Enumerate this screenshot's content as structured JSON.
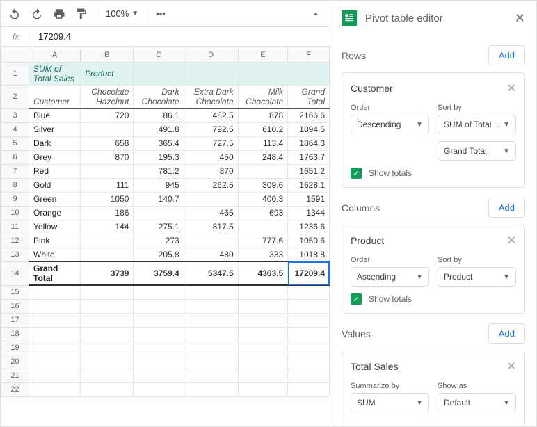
{
  "toolbar": {
    "zoom": "100%"
  },
  "fx": {
    "label": "fx",
    "value": "17209.4"
  },
  "grid": {
    "cols": [
      "A",
      "B",
      "C",
      "D",
      "E",
      "F"
    ],
    "hdr1": {
      "a": "SUM of Total Sales",
      "b": "Product"
    },
    "hdr2": [
      "Customer",
      "Chocolate Hazelnut",
      "Dark Chocolate",
      "Extra Dark Chocolate",
      "Milk Chocolate",
      "Grand Total"
    ],
    "rows": [
      {
        "n": "3",
        "c": "Blue",
        "v": [
          "720",
          "86.1",
          "482.5",
          "878",
          "2166.6"
        ]
      },
      {
        "n": "4",
        "c": "Silver",
        "v": [
          "",
          "491.8",
          "792.5",
          "610.2",
          "1894.5"
        ]
      },
      {
        "n": "5",
        "c": "Dark",
        "v": [
          "658",
          "365.4",
          "727.5",
          "113.4",
          "1864.3"
        ]
      },
      {
        "n": "6",
        "c": "Grey",
        "v": [
          "870",
          "195.3",
          "450",
          "248.4",
          "1763.7"
        ]
      },
      {
        "n": "7",
        "c": "Red",
        "v": [
          "",
          "781.2",
          "870",
          "",
          "1651.2"
        ]
      },
      {
        "n": "8",
        "c": "Gold",
        "v": [
          "111",
          "945",
          "262.5",
          "309.6",
          "1628.1"
        ]
      },
      {
        "n": "9",
        "c": "Green",
        "v": [
          "1050",
          "140.7",
          "",
          "400.3",
          "1591"
        ]
      },
      {
        "n": "10",
        "c": "Orange",
        "v": [
          "186",
          "",
          "465",
          "693",
          "1344"
        ]
      },
      {
        "n": "11",
        "c": "Yellow",
        "v": [
          "144",
          "275.1",
          "817.5",
          "",
          "1236.6"
        ]
      },
      {
        "n": "12",
        "c": "Pink",
        "v": [
          "",
          "273",
          "",
          "777.6",
          "1050.6"
        ]
      },
      {
        "n": "13",
        "c": "White",
        "v": [
          "",
          "205.8",
          "480",
          "333",
          "1018.8"
        ]
      }
    ],
    "total": {
      "n": "14",
      "lbl": "Grand Total",
      "v": [
        "3739",
        "3759.4",
        "5347.5",
        "4363.5",
        "17209.4"
      ]
    },
    "empty": [
      "15",
      "16",
      "17",
      "18",
      "19",
      "20",
      "21",
      "22"
    ]
  },
  "editor": {
    "title": "Pivot table editor",
    "add": "Add",
    "show_totals": "Show totals",
    "order_lbl": "Order",
    "sortby_lbl": "Sort by",
    "summarize_lbl": "Summarize by",
    "showas_lbl": "Show as",
    "sections": {
      "rows": {
        "title": "Rows"
      },
      "columns": {
        "title": "Columns"
      },
      "values": {
        "title": "Values"
      }
    },
    "cards": {
      "customer": {
        "title": "Customer",
        "order": "Descending",
        "sortby": "SUM of Total ...",
        "extra": "Grand Total"
      },
      "product": {
        "title": "Product",
        "order": "Ascending",
        "sortby": "Product"
      },
      "totalsales": {
        "title": "Total Sales",
        "summarize": "SUM",
        "showas": "Default"
      }
    }
  }
}
